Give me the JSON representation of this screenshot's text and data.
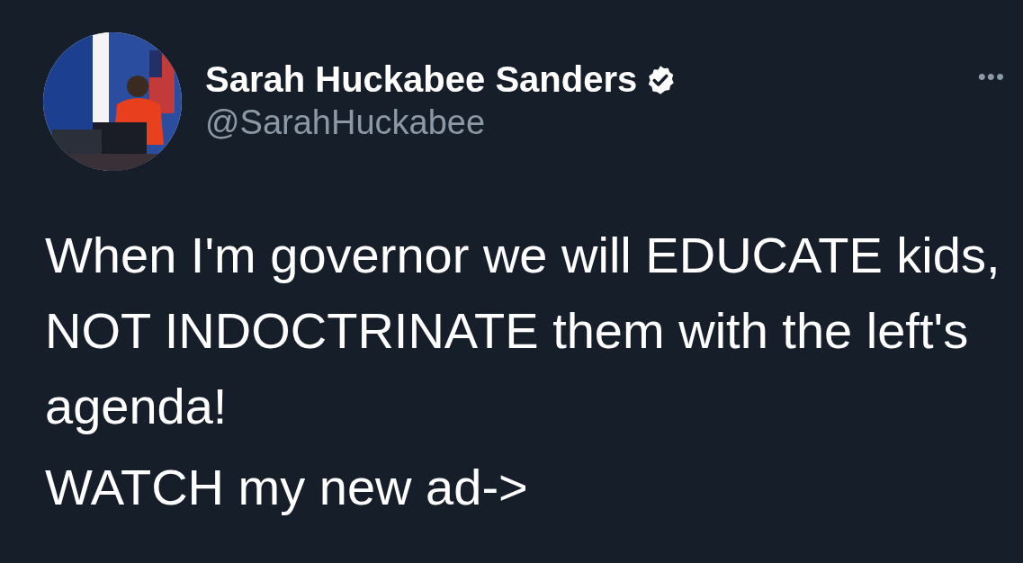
{
  "tweet": {
    "author": {
      "name": "Sarah Huckabee Sanders",
      "handle": "@SarahHuckabee",
      "verified": true
    },
    "more_menu": "•••",
    "paragraphs": [
      "When I'm governor we will EDUCATE kids, NOT INDOCTRINATE them with the left's agenda!",
      "WATCH my new ad->"
    ]
  }
}
